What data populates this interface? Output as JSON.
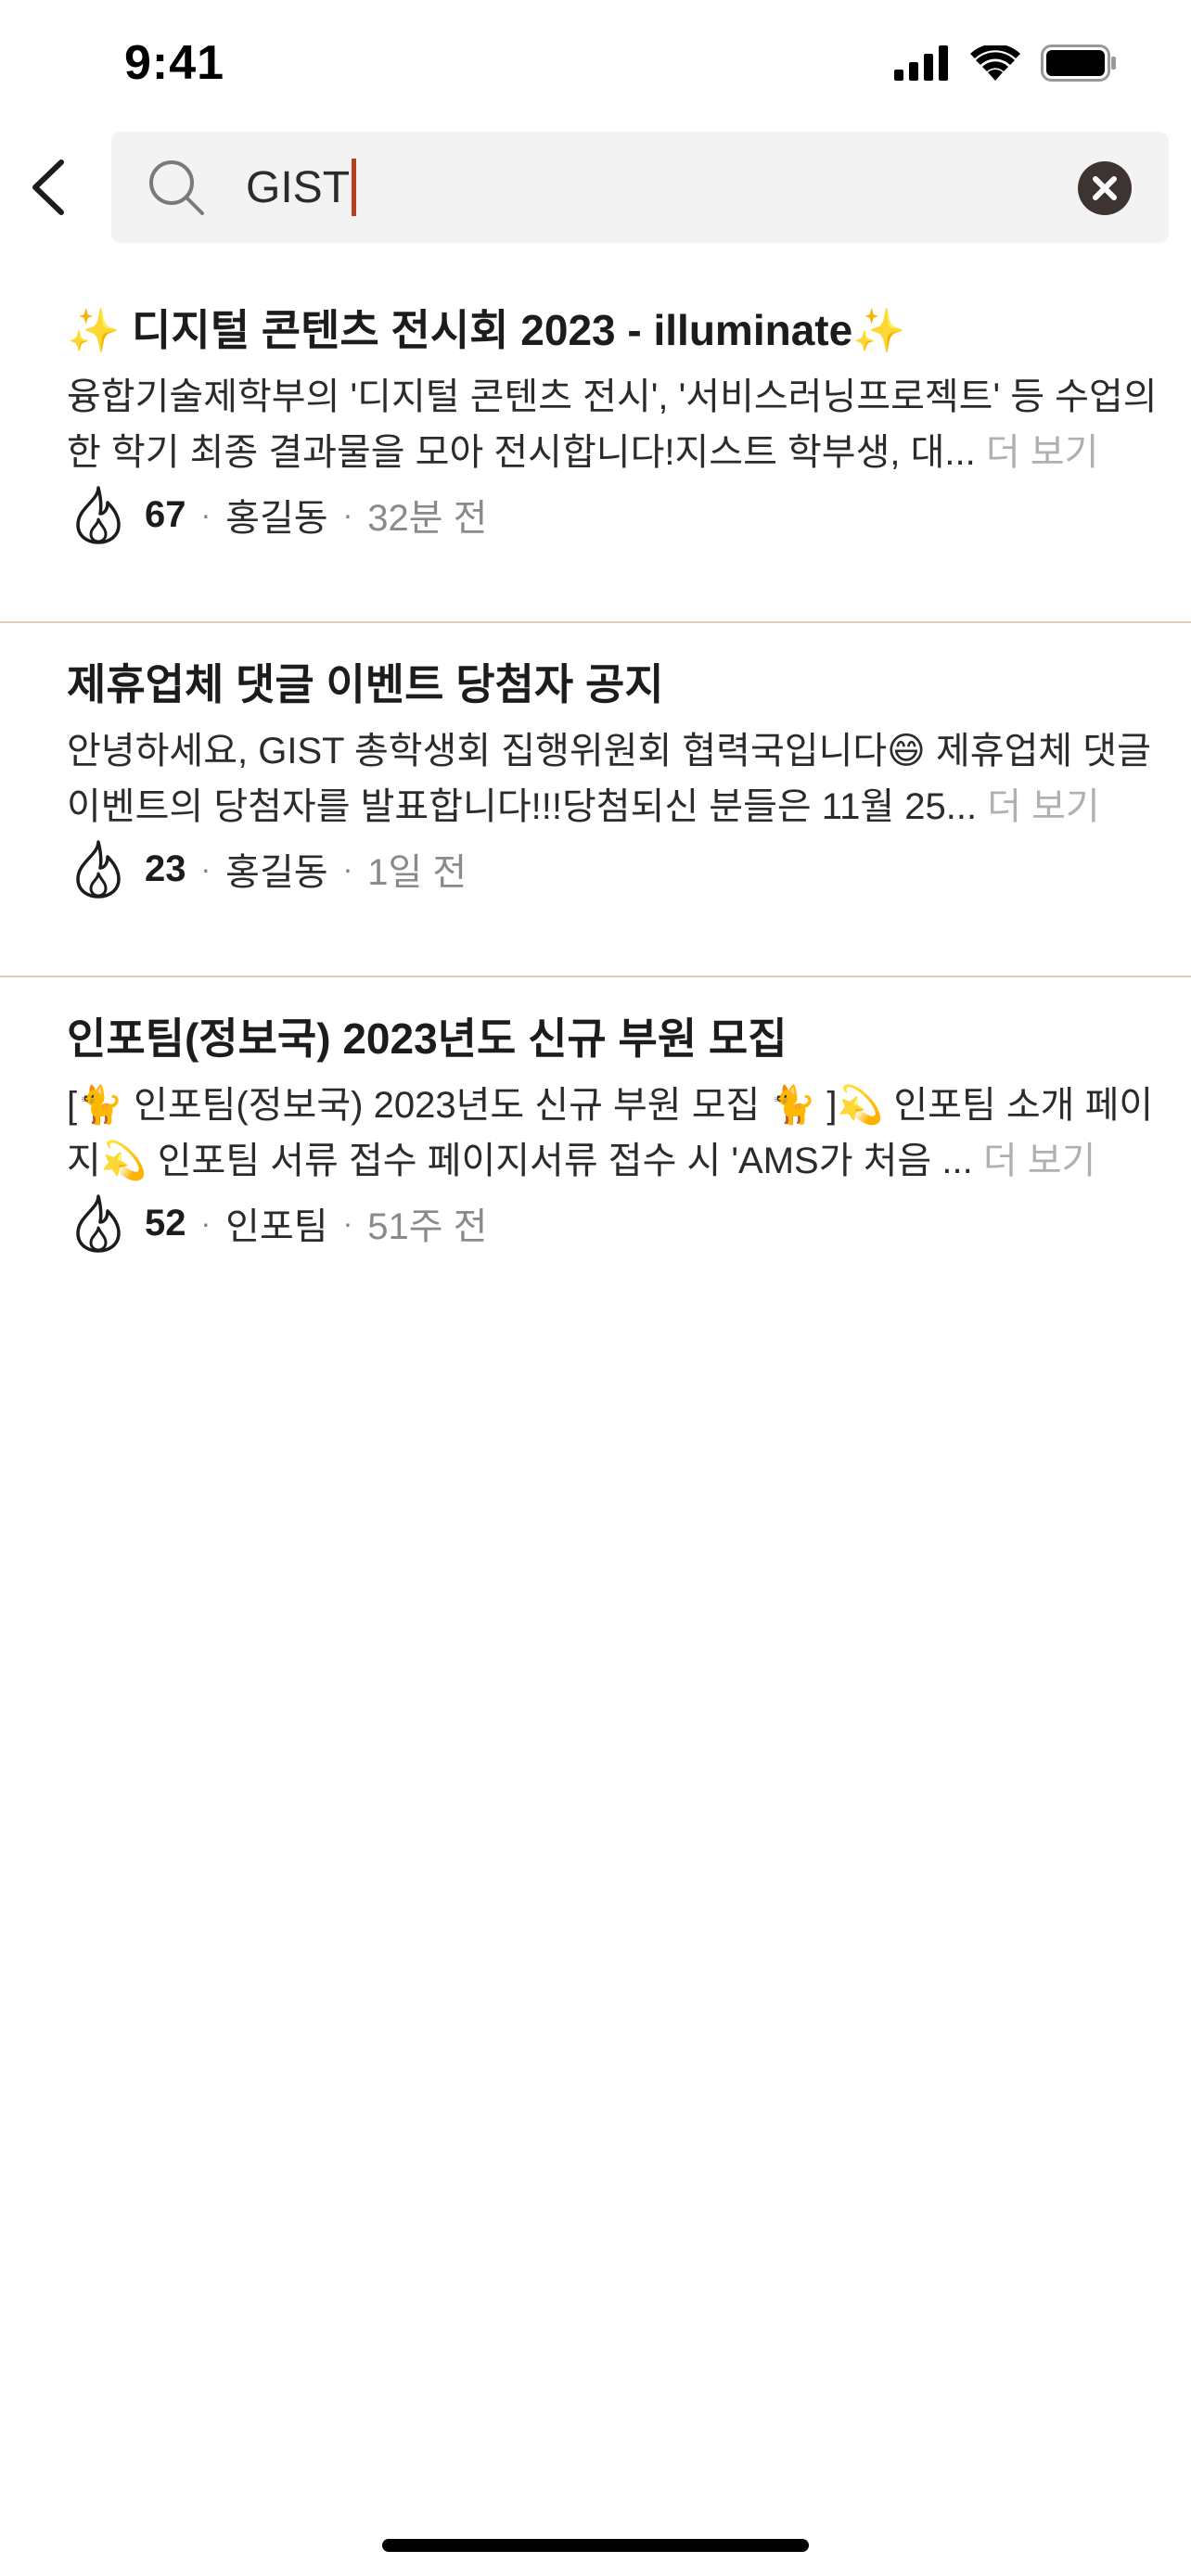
{
  "status_bar": {
    "time": "9:41"
  },
  "search": {
    "query": "GIST"
  },
  "results": [
    {
      "title": "✨  디지털 콘텐츠 전시회 2023 - illuminate✨",
      "body": "융합기술제학부의 '디지털 콘텐츠 전시', '서비스러닝프로젝트' 등 수업의 한 학기 최종 결과물을 모아 전시합니다!지스트 학부생, 대...",
      "more": "더 보기",
      "likes": "67",
      "author": "홍길동",
      "time": "32분 전"
    },
    {
      "title": "제휴업체 댓글 이벤트 당첨자 공지",
      "body": "안녕하세요, GIST 총학생회 집행위원회 협력국입니다😄 제휴업체 댓글 이벤트의 당첨자를 발표합니다!!!당첨되신 분들은 11월 25...",
      "more": "더 보기",
      "likes": "23",
      "author": "홍길동",
      "time": "1일 전"
    },
    {
      "title": "인포팀(정보국) 2023년도 신규 부원 모집",
      "body": "[🐈 인포팀(정보국) 2023년도 신규 부원 모집 🐈 ]💫  인포팀 소개 페이지💫  인포팀 서류 접수 페이지서류 접수 시 'AMS가 처음  ...",
      "more": "더 보기",
      "likes": "52",
      "author": "인포팀",
      "time": "51주 전"
    }
  ],
  "colors": {
    "accent": "#b5411f",
    "divider": "#e8c9bf",
    "search_bg": "#f3f3f3",
    "clear_icon": "#3d3331"
  },
  "icons": {
    "back": "chevron-left-icon",
    "search": "search-icon",
    "clear": "clear-icon",
    "likes": "fire-icon"
  }
}
